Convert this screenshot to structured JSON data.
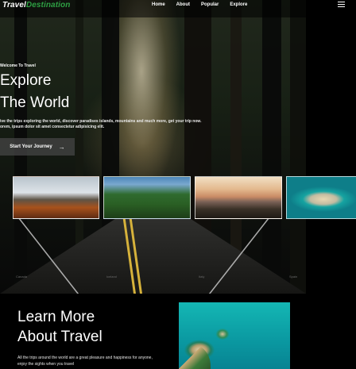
{
  "brand": {
    "prefix": "Travel",
    "accent": "Destination",
    "accent_color": "#2ea043"
  },
  "nav": {
    "items": [
      "Home",
      "About",
      "Popular",
      "Explore"
    ],
    "menu_icon": "hamburger-icon"
  },
  "hero": {
    "eyebrow": "Welcome To Travel",
    "title_line1": "Explore",
    "title_line2": "The World",
    "description": "ive the trips exploring the world, discover paradises islands, mountains and much more, get your trip now.\norem, ipsum dolor sit amet consectetur adipisicing elit.",
    "cta_label": "Start Your Journey",
    "cta_icon": "arrow-right-icon"
  },
  "cards": [
    {
      "caption": "Canada"
    },
    {
      "caption": "Iceland"
    },
    {
      "caption": "Italy"
    },
    {
      "caption": "Spain"
    }
  ],
  "about": {
    "title_line1": "Learn More",
    "title_line2": "About Travel",
    "text": "All the trips around the world are a great pleasure and happiness for anyone, enjoy the sights when you travel"
  }
}
